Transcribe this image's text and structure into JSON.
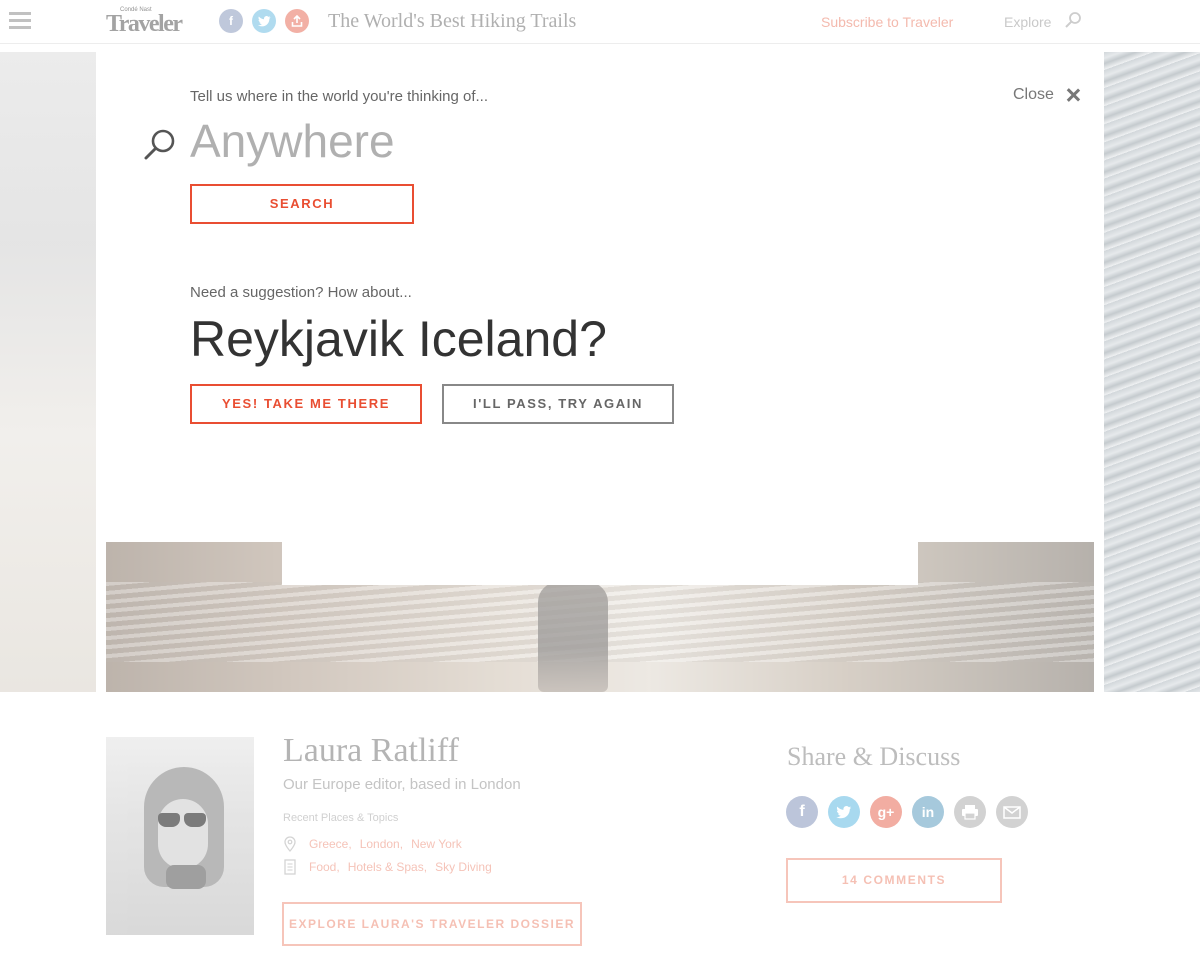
{
  "nav": {
    "logo_small": "Condé Nast",
    "logo": "Traveler",
    "page_title": "The World's Best Hiking Trails",
    "subscribe": "Subscribe to Traveler",
    "explore": "Explore"
  },
  "overlay": {
    "prompt": "Tell us where in the world you're thinking of...",
    "close_label": "Close",
    "search_placeholder": "Anywhere",
    "search_button": "SEARCH",
    "suggestion_prompt": "Need a suggestion? How about...",
    "suggestion": "Reykjavik Iceland?",
    "accept_button": "YES! TAKE ME THERE",
    "pass_button": "I'LL PASS, TRY AGAIN"
  },
  "author": {
    "name": "Laura Ratliff",
    "bio": "Our Europe editor, based in London",
    "recent_label": "Recent Places & Topics",
    "places": [
      "Greece,",
      "London,",
      "New York"
    ],
    "topics": [
      "Food,",
      "Hotels & Spas,",
      "Sky Diving"
    ],
    "dossier_button": "EXPLORE LAURA'S TRAVELER DOSSIER"
  },
  "share": {
    "title": "Share & Discuss",
    "comments_button": "14 COMMENTS",
    "icons": [
      "facebook-icon",
      "twitter-icon",
      "google-plus-icon",
      "linkedin-icon",
      "print-icon",
      "email-icon"
    ]
  },
  "colors": {
    "accent": "#e94e32",
    "muted_button": "#888888"
  }
}
